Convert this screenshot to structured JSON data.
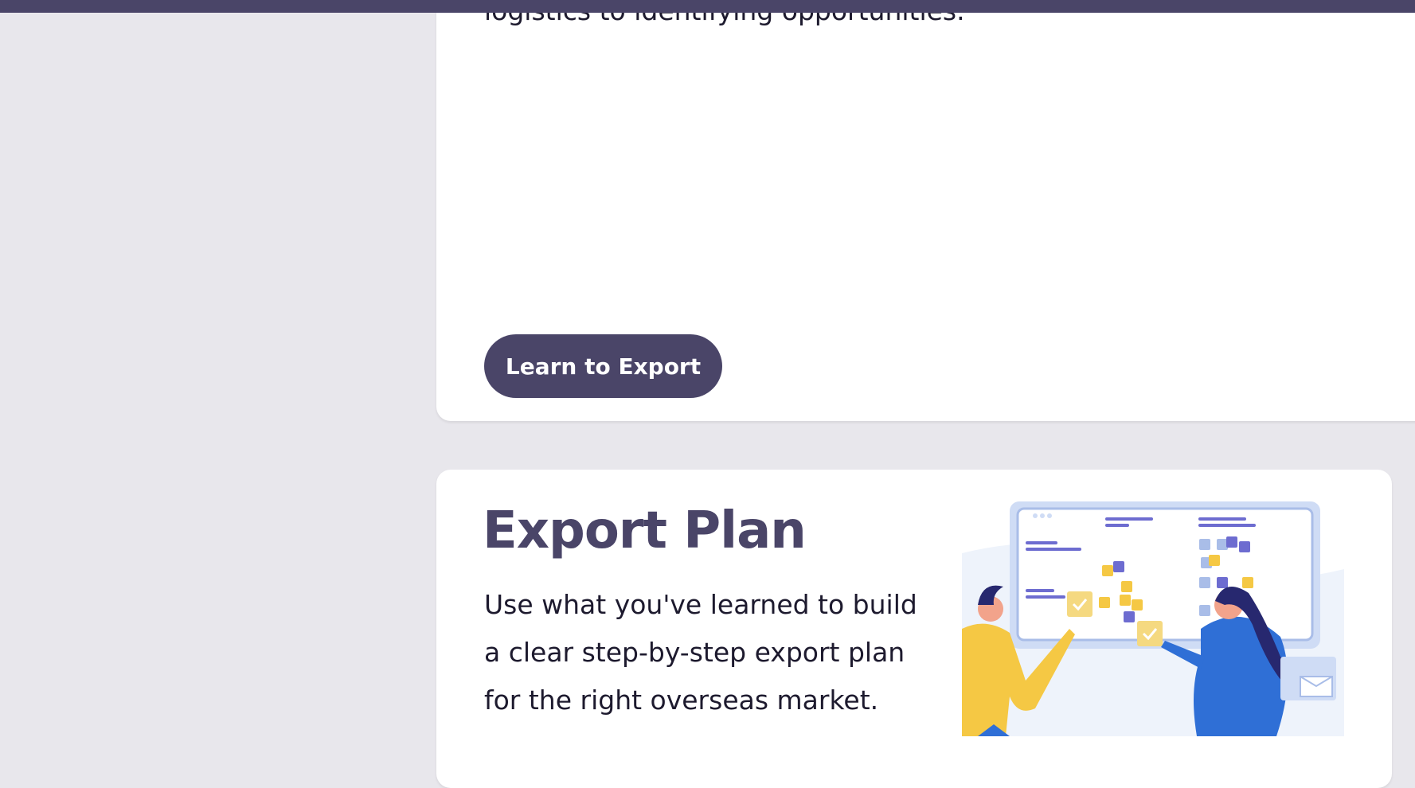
{
  "learn_card": {
    "intro_text": "logistics to identifying opportunities.",
    "button_label": "Learn to Export"
  },
  "plan_card": {
    "title": "Export Plan",
    "description_lines": [
      "Use what you've learned to build",
      "a clear step-by-step export plan",
      "for the right overseas market."
    ],
    "illustration": "export-plan-illustration"
  },
  "colors": {
    "accent": "#4a4568",
    "background": "#e8e7ec",
    "card": "#ffffff",
    "illustration_yellow": "#f5c844",
    "illustration_blue": "#2f6fd6",
    "illustration_violet": "#6d6cd0"
  }
}
